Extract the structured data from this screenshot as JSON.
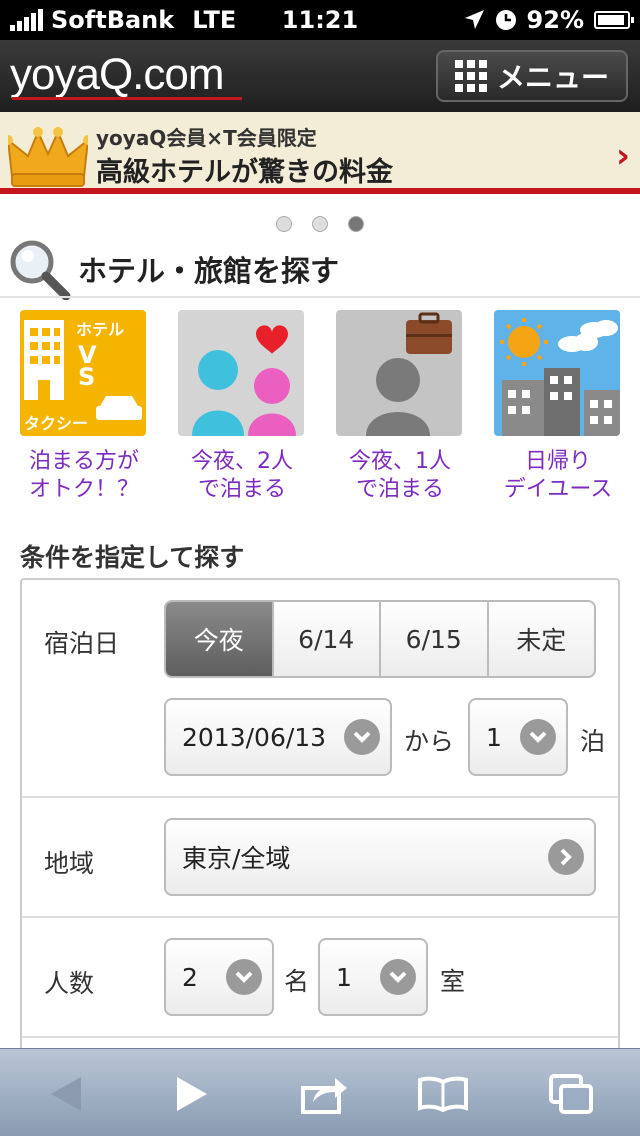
{
  "status_bar": {
    "carrier": "SoftBank",
    "network": "LTE",
    "time": "11:21",
    "battery": "92%"
  },
  "header": {
    "logo": "yoyaQ.com",
    "menu_label": "メニュー"
  },
  "banner": {
    "subtitle": "yoyaQ会員×T会員限定",
    "title": "高級ホテルが驚きの料金"
  },
  "pager": {
    "pages": 3,
    "active_index": 2
  },
  "search": {
    "title": "ホテル・旅館を探す",
    "tiles": [
      {
        "icon": "hotel-vs-taxi-icon",
        "tile_text_1": "ホテル",
        "tile_text_2": "VS",
        "tile_text_3": "タクシー",
        "caption_1": "泊まる方が",
        "caption_2": "オトク！？"
      },
      {
        "icon": "couple-icon",
        "caption_1": "今夜、2人",
        "caption_2": "で泊まる"
      },
      {
        "icon": "single-traveler-icon",
        "caption_1": "今夜、1人",
        "caption_2": "で泊まる"
      },
      {
        "icon": "day-use-icon",
        "caption_1": "日帰り",
        "caption_2": "デイユース"
      }
    ]
  },
  "conditions": {
    "title": "条件を指定して探す",
    "stay_date": {
      "label": "宿泊日",
      "options": [
        "今夜",
        "6/14",
        "6/15",
        "未定"
      ],
      "selected": "今夜",
      "date_value": "2013/06/13",
      "from_label": "から",
      "nights_value": "1",
      "nights_label": "泊"
    },
    "area": {
      "label": "地域",
      "value": "東京/全域"
    },
    "people": {
      "label": "人数",
      "count_value": "2",
      "count_unit": "名",
      "rooms_value": "1",
      "rooms_unit": "室"
    }
  },
  "colors": {
    "accent_red": "#c4171d",
    "link_purple": "#7d2bc1",
    "banner_bg": "#f3ecd6"
  }
}
